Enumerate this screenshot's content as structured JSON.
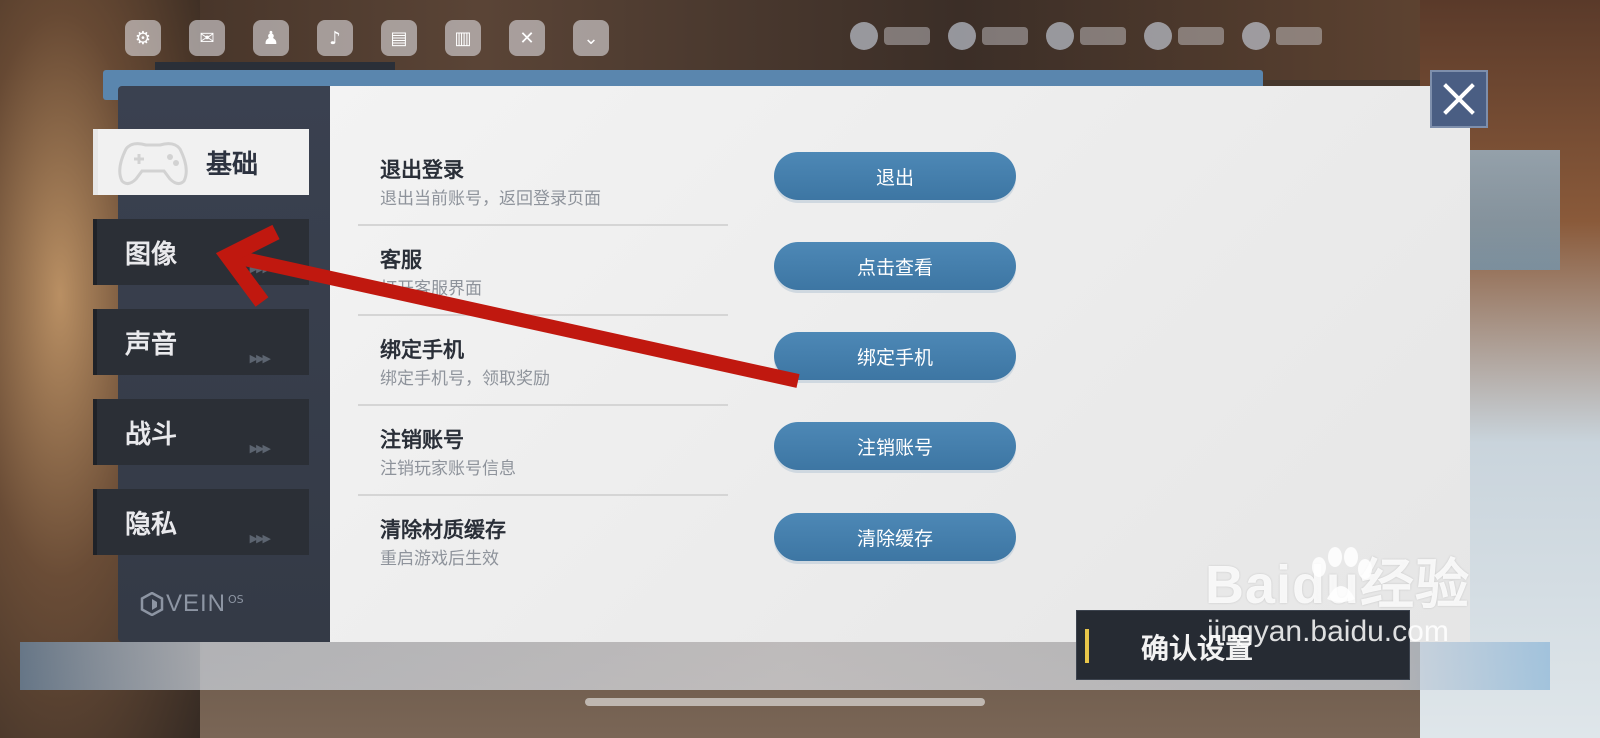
{
  "sidebar": {
    "items": [
      {
        "label": "基础",
        "active": true
      },
      {
        "label": "图像",
        "active": false
      },
      {
        "label": "声音",
        "active": false
      },
      {
        "label": "战斗",
        "active": false
      },
      {
        "label": "隐私",
        "active": false
      }
    ],
    "logo_text": "VEIN",
    "logo_sup": "OS"
  },
  "settings": [
    {
      "title": "退出登录",
      "desc": "退出当前账号，返回登录页面",
      "button": "退出"
    },
    {
      "title": "客服",
      "desc": "打开客服界面",
      "button": "点击查看"
    },
    {
      "title": "绑定手机",
      "desc": "绑定手机号，领取奖励",
      "button": "绑定手机"
    },
    {
      "title": "注销账号",
      "desc": "注销玩家账号信息",
      "button": "注销账号"
    },
    {
      "title": "清除材质缓存",
      "desc": "重启游戏后生效",
      "button": "清除缓存"
    }
  ],
  "footer": {
    "confirm_label": "确认设置"
  },
  "watermark": {
    "main": "Baidu经验",
    "sub": "jingyan.baidu.com"
  },
  "colors": {
    "button": "#4682b0",
    "annotation_arrow": "#c0180f",
    "confirm_accent": "#e8c64a"
  },
  "icons": {
    "close": "close-icon",
    "active_tab": "gamepad-icon"
  }
}
